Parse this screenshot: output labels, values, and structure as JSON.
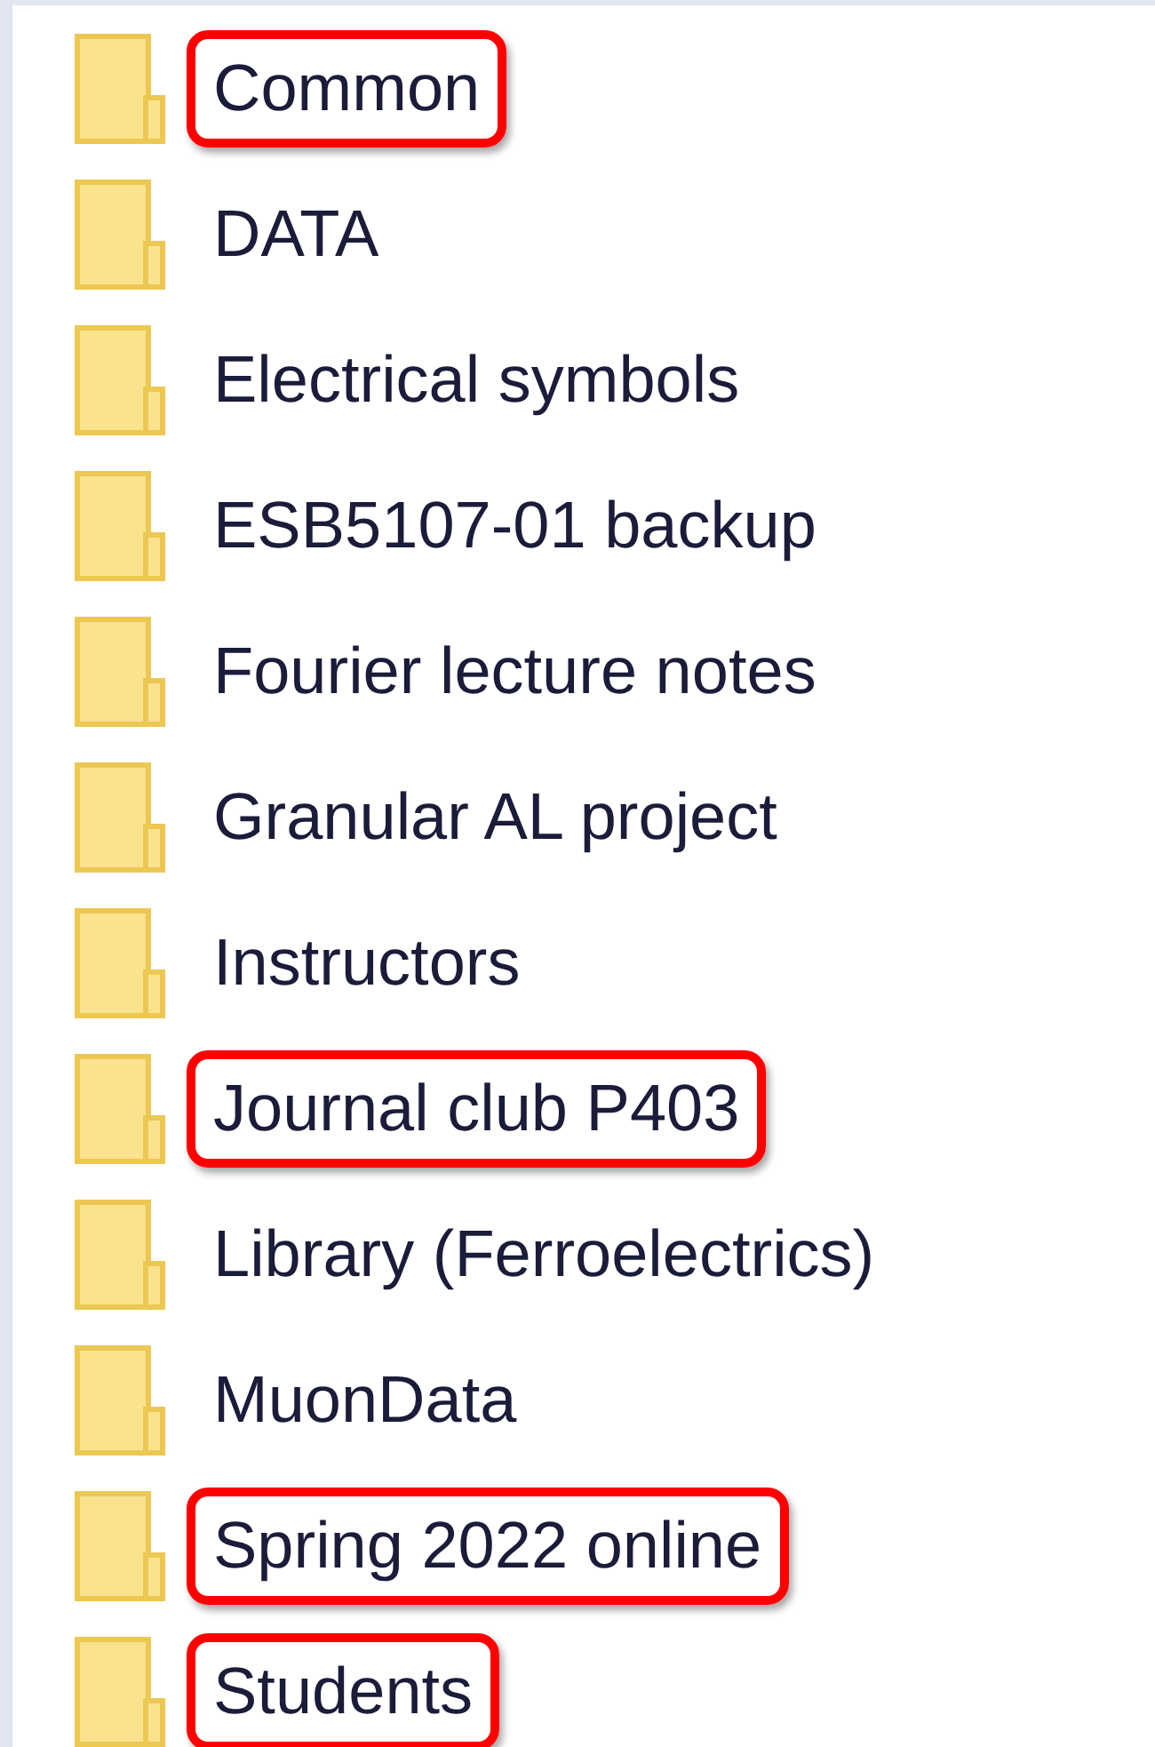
{
  "folders": [
    {
      "name": "Common",
      "highlighted": true
    },
    {
      "name": "DATA",
      "highlighted": false
    },
    {
      "name": "Electrical symbols",
      "highlighted": false
    },
    {
      "name": "ESB5107-01 backup",
      "highlighted": false
    },
    {
      "name": "Fourier lecture notes",
      "highlighted": false
    },
    {
      "name": "Granular AL project",
      "highlighted": false
    },
    {
      "name": "Instructors",
      "highlighted": false
    },
    {
      "name": "Journal club P403",
      "highlighted": true
    },
    {
      "name": "Library (Ferroelectrics)",
      "highlighted": false
    },
    {
      "name": "MuonData",
      "highlighted": false
    },
    {
      "name": "Spring 2022 online",
      "highlighted": true
    },
    {
      "name": "Students",
      "highlighted": true
    }
  ]
}
